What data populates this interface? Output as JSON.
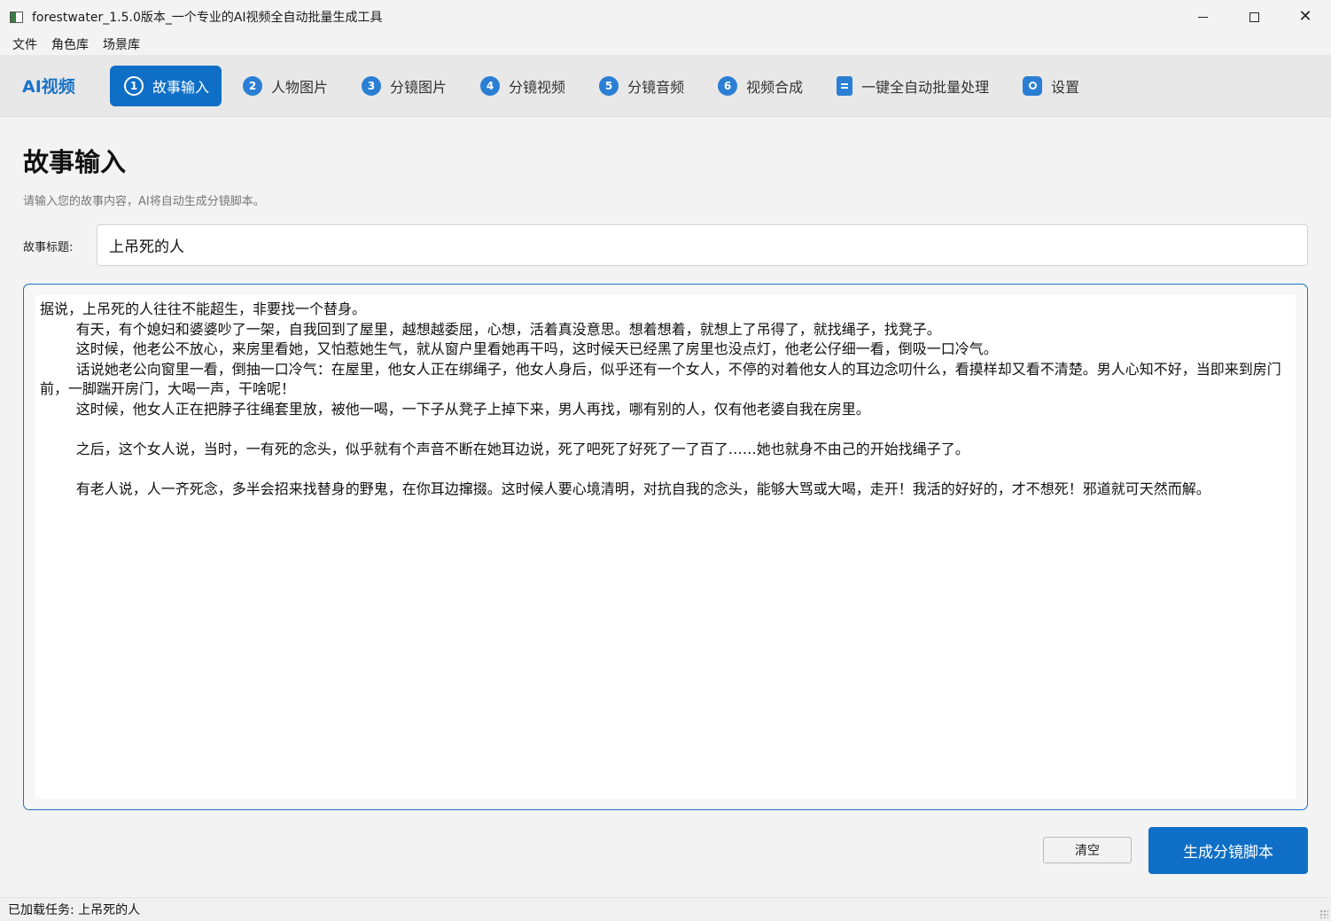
{
  "window": {
    "title": "forestwater_1.5.0版本_一个专业的AI视频全自动批量生成工具"
  },
  "menu": {
    "items": [
      "文件",
      "角色库",
      "场景库"
    ]
  },
  "nav": {
    "brand": "AI视频",
    "tabs": [
      {
        "step": "1",
        "label": "故事输入",
        "active": true
      },
      {
        "step": "2",
        "label": "人物图片"
      },
      {
        "step": "3",
        "label": "分镜图片"
      },
      {
        "step": "4",
        "label": "分镜视频"
      },
      {
        "step": "5",
        "label": "分镜音频"
      },
      {
        "step": "6",
        "label": "视频合成"
      },
      {
        "icon": "document-icon",
        "label": "一键全自动批量处理"
      },
      {
        "icon": "gear-icon",
        "label": "设置"
      }
    ]
  },
  "page": {
    "title": "故事输入",
    "subtitle": "请输入您的故事内容，AI将自动生成分镜脚本。",
    "story_title_label": "故事标题:",
    "story_title_value": "上吊死的人",
    "story_content": "据说，上吊死的人往往不能超生，非要找一个替身。\n        有天，有个媳妇和婆婆吵了一架，自我回到了屋里，越想越委屈，心想，活着真没意思。想着想着，就想上了吊得了，就找绳子，找凳子。\n        这时候，他老公不放心，来房里看她，又怕惹她生气，就从窗户里看她再干吗，这时候天已经黑了房里也没点灯，他老公仔细一看，倒吸一口冷气。\n        话说她老公向窗里一看，倒抽一口冷气：在屋里，他女人正在绑绳子，他女人身后，似乎还有一个女人，不停的对着他女人的耳边念叨什么，看摸样却又看不清楚。男人心知不好，当即来到房门前，一脚踹开房门，大喝一声，干啥呢！\n        这时候，他女人正在把脖子往绳套里放，被他一喝，一下子从凳子上掉下来，男人再找，哪有别的人，仅有他老婆自我在房里。\n\n        之后，这个女人说，当时，一有死的念头，似乎就有个声音不断在她耳边说，死了吧死了好死了一了百了……她也就身不由己的开始找绳子了。\n\n        有老人说，人一齐死念，多半会招来找替身的野鬼，在你耳边撺掇。这时候人要心境清明，对抗自我的念头，能够大骂或大喝，走开！我活的好好的，才不想死！邪道就可天然而解。"
  },
  "buttons": {
    "clear": "清空",
    "generate": "生成分镜脚本"
  },
  "status": {
    "text": "已加载任务: 上吊死的人"
  },
  "colors": {
    "accent": "#0f6fc6",
    "brand": "#1a73c8"
  }
}
